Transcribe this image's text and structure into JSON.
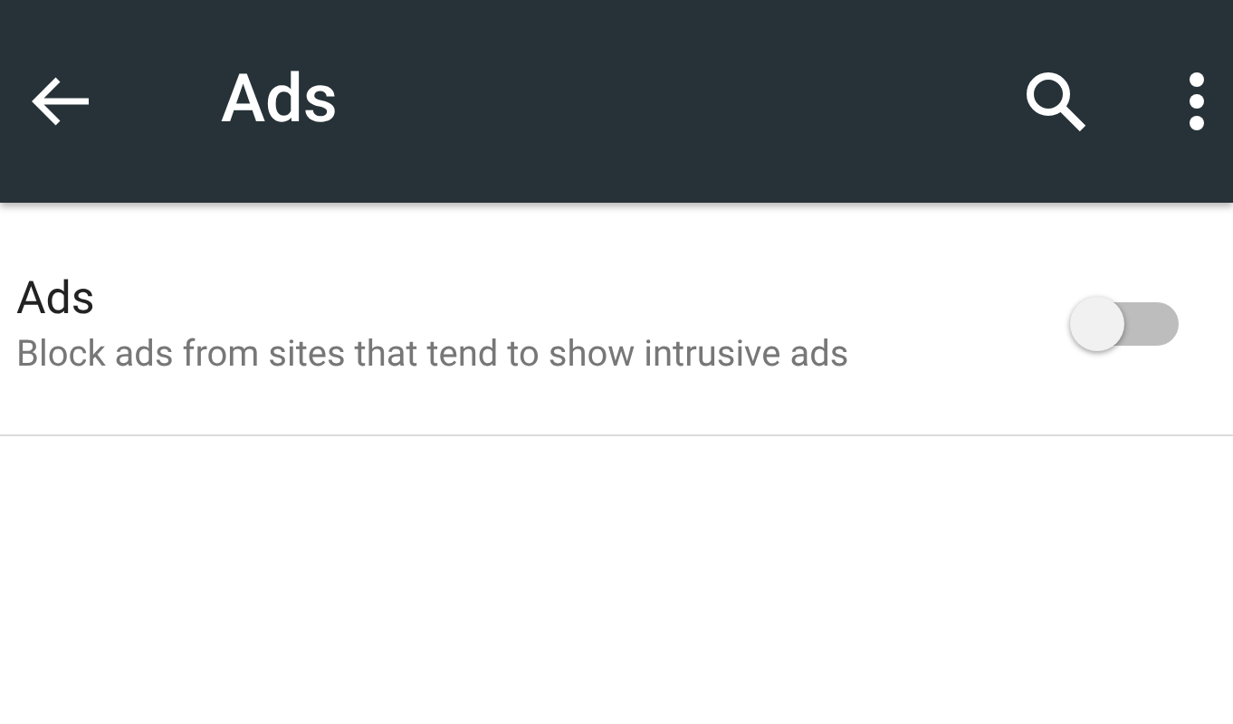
{
  "toolbar": {
    "title": "Ads"
  },
  "setting": {
    "title": "Ads",
    "summary": "Block ads from sites that tend to show intrusive ads",
    "on": false
  }
}
